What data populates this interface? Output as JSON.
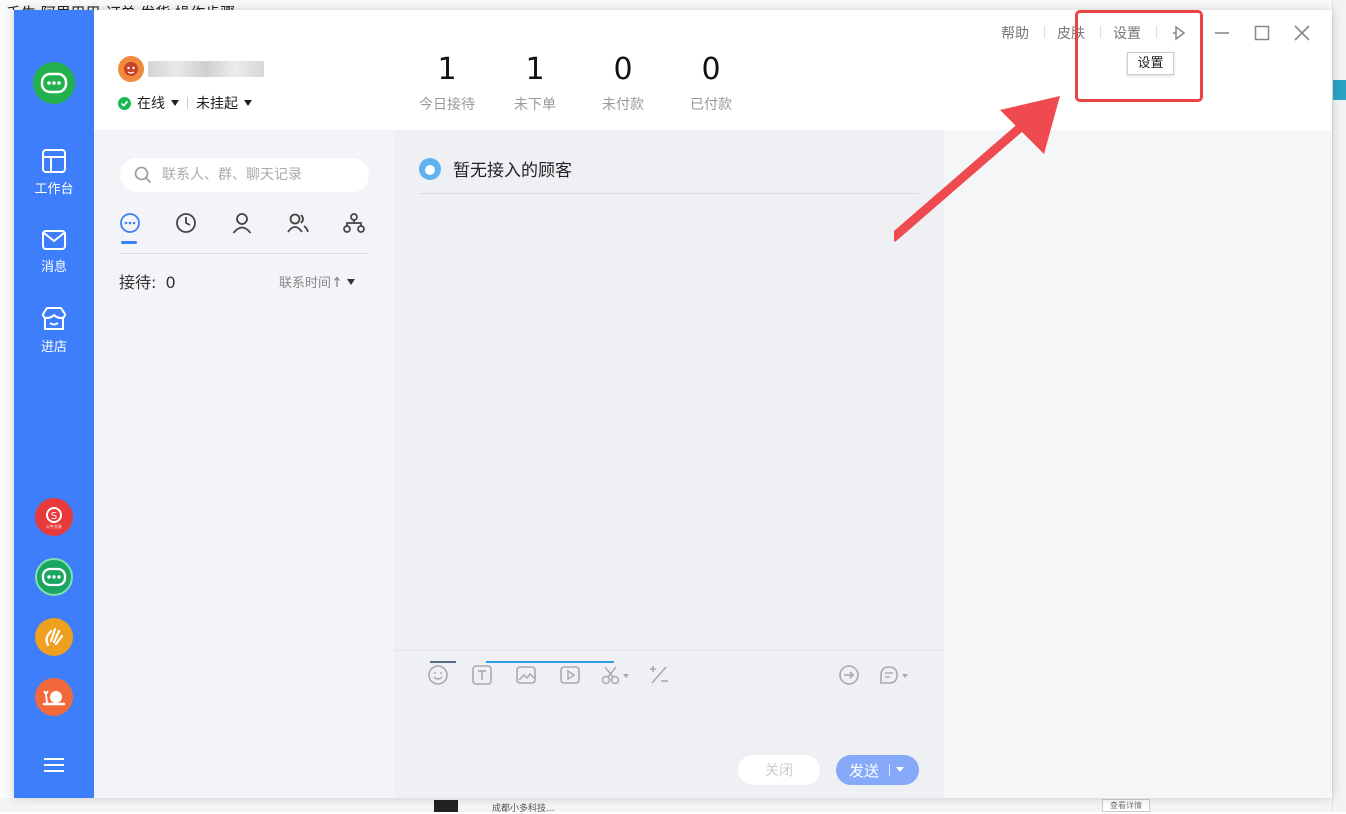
{
  "background": {
    "title_fragment": "千牛 阿里巴巴 订单 发货 操作步骤",
    "bottom_item_text": "成都小多科技...",
    "bottom_button": "查看详情"
  },
  "sidebar": {
    "logo_icon": "qianniu-logo-icon",
    "items": [
      {
        "icon": "workbench-icon",
        "label": "工作台"
      },
      {
        "icon": "mail-icon",
        "label": "消息"
      },
      {
        "icon": "store-icon",
        "label": "进店"
      }
    ],
    "apps": [
      {
        "icon": "huoniu-trade-icon",
        "label": "火牛交易",
        "color": "#e83a3a"
      },
      {
        "icon": "qianniu-chat-icon",
        "color": "#1aa560"
      },
      {
        "icon": "hand-icon",
        "color": "#f0a020"
      },
      {
        "icon": "snail-icon",
        "color": "#f26a3c"
      }
    ],
    "menu_icon": "menu-icon"
  },
  "account": {
    "status": "在线",
    "hangup": "未挂起"
  },
  "stats": [
    {
      "value": "1",
      "label": "今日接待"
    },
    {
      "value": "1",
      "label": "未下单"
    },
    {
      "value": "0",
      "label": "未付款"
    },
    {
      "value": "0",
      "label": "已付款"
    }
  ],
  "top_links": {
    "help": "帮助",
    "skin": "皮肤",
    "settings": "设置",
    "tooltip": "设置"
  },
  "left_panel": {
    "search_placeholder": "联系人、群、聊天记录",
    "tabs": [
      "chat-tab-icon",
      "history-clock-icon",
      "contact-person-icon",
      "group-icon",
      "org-structure-icon"
    ],
    "receive_label": "接待:",
    "receive_count": "0",
    "sort_label": "联系时间"
  },
  "center": {
    "empty_title": "暂无接入的顾客",
    "tools": [
      "emoji-icon",
      "text-format-icon",
      "image-icon",
      "video-icon",
      "scissors-icon",
      "quick-phrase-icon",
      "transfer-icon",
      "evaluation-icon"
    ],
    "close_button": "关闭",
    "send_button": "发送"
  },
  "colors": {
    "sidebar": "#3e7efb",
    "annotation": "#e94346",
    "send": "#86aaf9"
  }
}
